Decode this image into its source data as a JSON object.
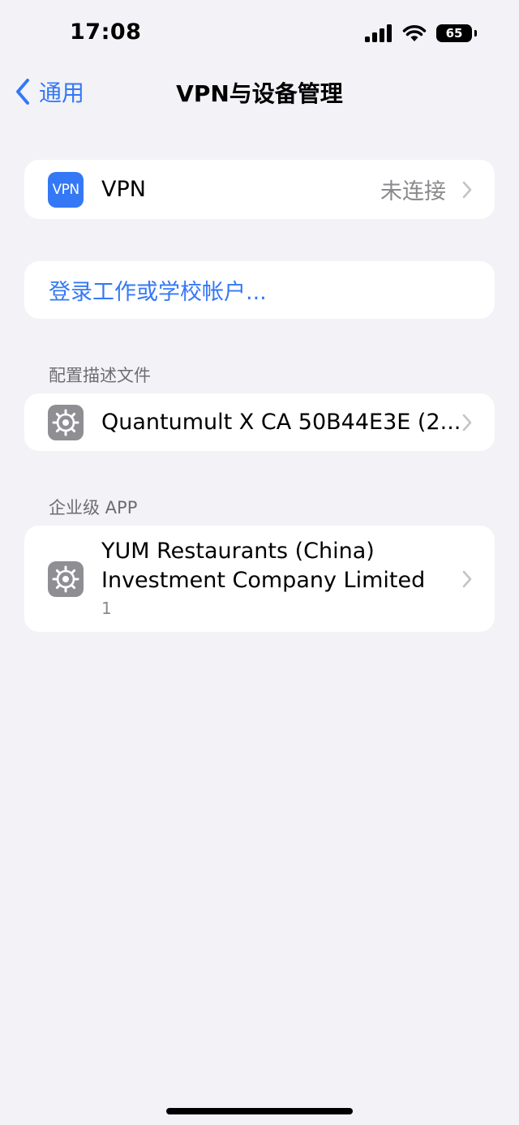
{
  "status_bar": {
    "time": "17:08",
    "battery": "65",
    "signal_icon": "cellular-signal-icon",
    "wifi_icon": "wifi-icon"
  },
  "nav": {
    "back_label": "通用",
    "title": "VPN与设备管理"
  },
  "vpn_row": {
    "icon_text": "VPN",
    "label": "VPN",
    "status": "未连接"
  },
  "login_row": {
    "label": "登录工作或学校帐户..."
  },
  "profiles_section": {
    "header": "配置描述文件",
    "items": [
      {
        "label": "Quantumult X CA 50B44E3E (2..."
      }
    ]
  },
  "enterprise_section": {
    "header": "企业级 APP",
    "items": [
      {
        "line1": "YUM Restaurants (China)",
        "line2": "Investment Company Limited",
        "count": "1"
      }
    ]
  },
  "colors": {
    "accent": "#3478f6",
    "background": "#f2f2f7",
    "secondary_text": "#8a8a8e",
    "gear_icon_bg": "#8e8e93"
  }
}
